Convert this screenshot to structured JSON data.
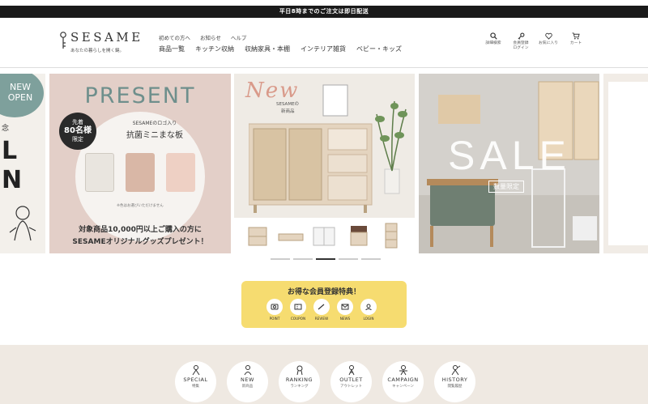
{
  "announcement": "平日8時までのご注文は即日配送",
  "header": {
    "brand": "SESAME",
    "tagline": "あなたの暮らしを開く鍵。",
    "subnav": [
      "初めての方へ",
      "お知らせ",
      "ヘルプ"
    ],
    "mainnav": [
      "商品一覧",
      "キッチン収納",
      "収納家具・本棚",
      "インテリア雑貨",
      "ベビー・キッズ"
    ],
    "utils": [
      {
        "icon": "search-icon",
        "label": "詳細検索"
      },
      {
        "icon": "key-icon",
        "label": "会員登録\nログイン"
      },
      {
        "icon": "heart-icon",
        "label": "お気に入り"
      },
      {
        "icon": "cart-icon",
        "label": "カート"
      }
    ]
  },
  "slides": {
    "left": {
      "badge": "NEW OPEN",
      "side": "念",
      "big": "L\nN"
    },
    "present": {
      "title": "PRESENT",
      "badge_line1": "先着",
      "badge_line2": "80名様",
      "badge_line3": "限定",
      "sub": "SESAMEのロゴ入り",
      "head": "抗菌ミニまな板",
      "note": "※色はお選びいただけません",
      "foot1": "対象商品10,000円以上ご購入の方に",
      "foot2": "SESAMEオリジナルグッズプレゼント！",
      "board_colors": [
        "#e9e5df",
        "#d9b7a6",
        "#eed0c4"
      ]
    },
    "new": {
      "script": "New",
      "sub1": "SESAMEの",
      "sub2": "新商品"
    },
    "sale": {
      "title": "SALE",
      "sub": "数量限定"
    }
  },
  "slider_dots": {
    "count": 5,
    "active_index": 2
  },
  "member": {
    "title": "お得な会員登録特典！",
    "items": [
      {
        "icon": "point-icon",
        "label": "POINT"
      },
      {
        "icon": "coupon-icon",
        "label": "COUPON"
      },
      {
        "icon": "review-icon",
        "label": "REVIEW"
      },
      {
        "icon": "news-icon",
        "label": "NEWS"
      },
      {
        "icon": "login-icon",
        "label": "LOGIN"
      }
    ]
  },
  "categories": [
    {
      "en": "SPECIAL",
      "jp": "特集"
    },
    {
      "en": "NEW",
      "jp": "新商品"
    },
    {
      "en": "RANKING",
      "jp": "ランキング"
    },
    {
      "en": "OUTLET",
      "jp": "アウトレット"
    },
    {
      "en": "CAMPAIGN",
      "jp": "キャンペーン"
    },
    {
      "en": "HISTORY",
      "jp": "閲覧履歴"
    }
  ],
  "colors": {
    "accent_yellow": "#f6dc70",
    "present_green": "#6e8f8c",
    "bottom_bg": "#efe9e2",
    "dark": "#1a1a1a"
  }
}
